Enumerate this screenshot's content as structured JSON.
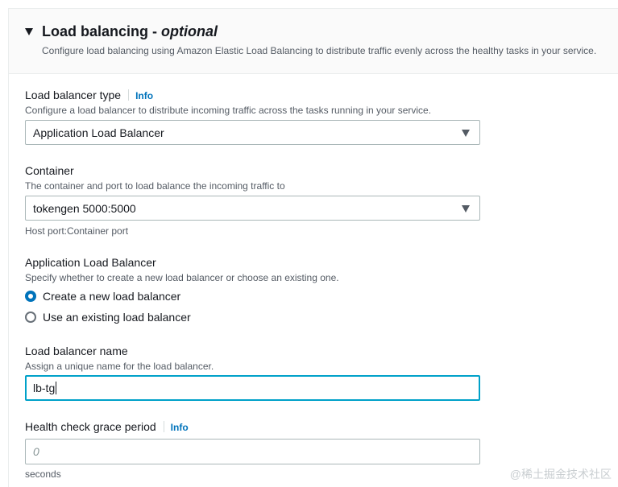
{
  "section": {
    "title": "Load balancing - ",
    "title_optional": "optional",
    "description": "Configure load balancing using Amazon Elastic Load Balancing to distribute traffic evenly across the healthy tasks in your service."
  },
  "lb_type": {
    "label": "Load balancer type",
    "info": "Info",
    "description": "Configure a load balancer to distribute incoming traffic across the tasks running in your service.",
    "value": "Application Load Balancer"
  },
  "container": {
    "label": "Container",
    "description": "The container and port to load balance the incoming traffic to",
    "value": "tokengen 5000:5000",
    "hint": "Host port:Container port"
  },
  "alb": {
    "label": "Application Load Balancer",
    "description": "Specify whether to create a new load balancer or choose an existing one.",
    "options": [
      {
        "label": "Create a new load balancer",
        "checked": true
      },
      {
        "label": "Use an existing load balancer",
        "checked": false
      }
    ]
  },
  "lb_name": {
    "label": "Load balancer name",
    "description": "Assign a unique name for the load balancer.",
    "value": "lb-tg"
  },
  "grace": {
    "label": "Health check grace period",
    "info": "Info",
    "placeholder": "0",
    "unit": "seconds"
  },
  "watermark": "@稀土掘金技术社区",
  "colors": {
    "accent": "#0073bb",
    "focus_border": "#00a1c9",
    "text": "#16191f",
    "secondary_text": "#545b64"
  }
}
